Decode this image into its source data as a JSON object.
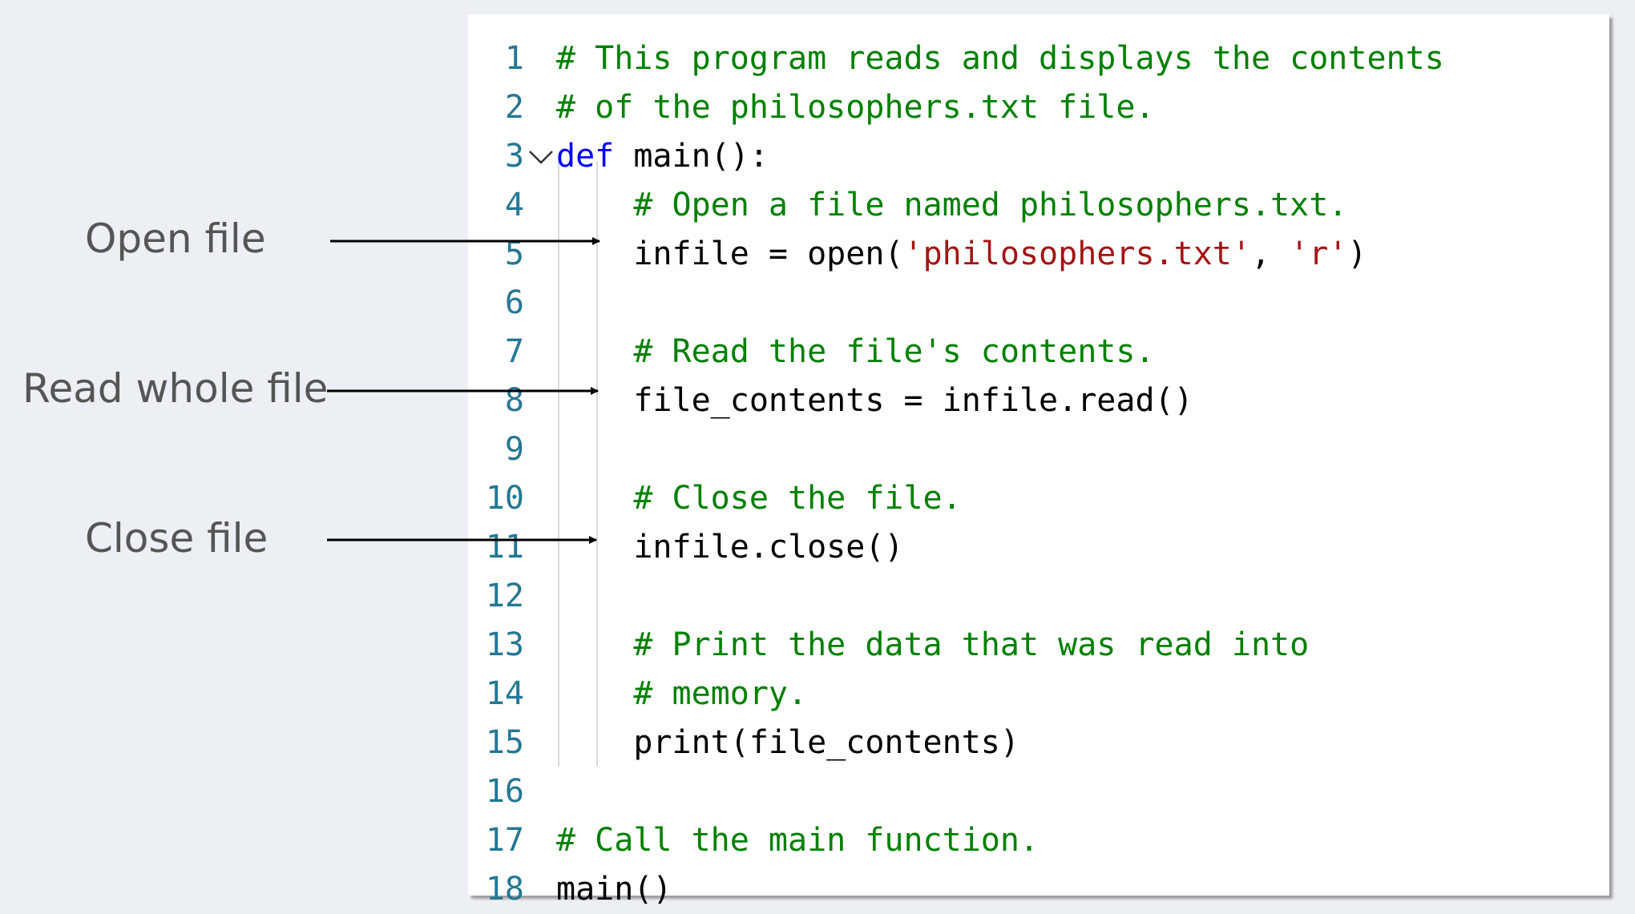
{
  "code_lines": [
    {
      "num": "1",
      "tokens": [
        {
          "t": "# This program reads and displays the contents",
          "c": "comment"
        }
      ]
    },
    {
      "num": "2",
      "tokens": [
        {
          "t": "# of the philosophers.txt file.",
          "c": "comment"
        }
      ]
    },
    {
      "num": "3",
      "tokens": [
        {
          "t": "def",
          "c": "keyword"
        },
        {
          "t": " main():",
          "c": "plain"
        }
      ]
    },
    {
      "num": "4",
      "tokens": [
        {
          "t": "    ",
          "c": "plain"
        },
        {
          "t": "# Open a file named philosophers.txt.",
          "c": "comment"
        }
      ]
    },
    {
      "num": "5",
      "tokens": [
        {
          "t": "    infile = open(",
          "c": "plain"
        },
        {
          "t": "'philosophers.txt'",
          "c": "string"
        },
        {
          "t": ", ",
          "c": "plain"
        },
        {
          "t": "'r'",
          "c": "string"
        },
        {
          "t": ")",
          "c": "plain"
        }
      ]
    },
    {
      "num": "6",
      "tokens": []
    },
    {
      "num": "7",
      "tokens": [
        {
          "t": "    ",
          "c": "plain"
        },
        {
          "t": "# Read the file's contents.",
          "c": "comment"
        }
      ]
    },
    {
      "num": "8",
      "tokens": [
        {
          "t": "    file_contents = infile.read()",
          "c": "plain"
        }
      ]
    },
    {
      "num": "9",
      "tokens": []
    },
    {
      "num": "10",
      "tokens": [
        {
          "t": "    ",
          "c": "plain"
        },
        {
          "t": "# Close the file.",
          "c": "comment"
        }
      ]
    },
    {
      "num": "11",
      "tokens": [
        {
          "t": "    infile.close()",
          "c": "plain"
        }
      ]
    },
    {
      "num": "12",
      "tokens": []
    },
    {
      "num": "13",
      "tokens": [
        {
          "t": "    ",
          "c": "plain"
        },
        {
          "t": "# Print the data that was read into",
          "c": "comment"
        }
      ]
    },
    {
      "num": "14",
      "tokens": [
        {
          "t": "    ",
          "c": "plain"
        },
        {
          "t": "# memory.",
          "c": "comment"
        }
      ]
    },
    {
      "num": "15",
      "tokens": [
        {
          "t": "    print(file_contents)",
          "c": "plain"
        }
      ]
    },
    {
      "num": "16",
      "tokens": []
    },
    {
      "num": "17",
      "tokens": [
        {
          "t": "# Call the main function.",
          "c": "comment"
        }
      ]
    },
    {
      "num": "18",
      "tokens": [
        {
          "t": "main()",
          "c": "plain"
        }
      ]
    }
  ],
  "annotations": {
    "open_file": "Open file",
    "read_whole_file": "Read whole file",
    "close_file": "Close file"
  },
  "colors": {
    "comment": "#008000",
    "keyword": "#0000ff",
    "string": "#a31515",
    "line_number": "#237893"
  },
  "icons": {
    "fold": "chevron-down-icon"
  }
}
